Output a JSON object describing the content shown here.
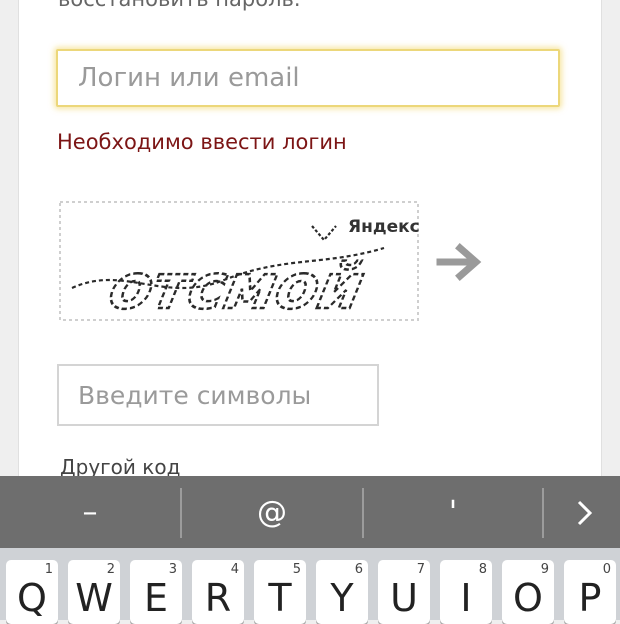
{
  "form": {
    "top_text": "восстановить пароль.",
    "login_placeholder": "Логин или email",
    "error": "Необходимо ввести логин",
    "captcha": {
      "text": "отсмой",
      "brand": "Яндекс"
    },
    "symbols_placeholder": "Введите символы",
    "other_code": "Другой код"
  },
  "suggestions": [
    "–",
    "@",
    "'"
  ],
  "keyboard": {
    "row": [
      {
        "ch": "Q",
        "num": "1"
      },
      {
        "ch": "W",
        "num": "2"
      },
      {
        "ch": "E",
        "num": "3"
      },
      {
        "ch": "R",
        "num": "4"
      },
      {
        "ch": "T",
        "num": "5"
      },
      {
        "ch": "Y",
        "num": "6"
      },
      {
        "ch": "U",
        "num": "7"
      },
      {
        "ch": "I",
        "num": "8"
      },
      {
        "ch": "O",
        "num": "9"
      },
      {
        "ch": "P",
        "num": "0"
      }
    ]
  },
  "colors": {
    "error": "#7c1515",
    "focus": "#ecd77a",
    "brand_red": "#e52620",
    "suggest_bar": "#6e6e6e"
  }
}
